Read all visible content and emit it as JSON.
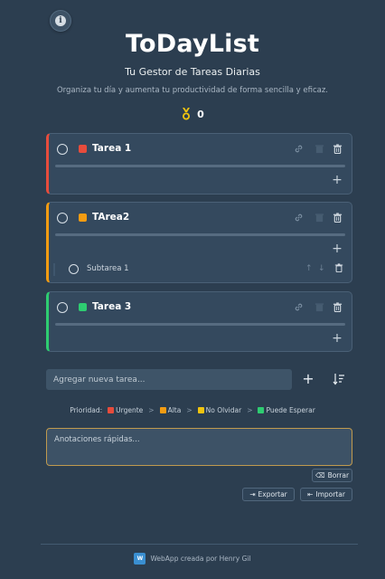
{
  "header": {
    "title": "ToDayList",
    "subtitle": "Tu Gestor de Tareas Diarias",
    "tagline": "Organiza tu día y aumenta tu productividad de forma sencilla y eficaz.",
    "medal_count": "0"
  },
  "tasks": [
    {
      "name": "Tarea 1",
      "color": "#e74c3c",
      "priority": "Urgente"
    },
    {
      "name": "TArea2",
      "color": "#f39c12",
      "priority": "Alta",
      "subtasks": [
        {
          "name": "Subtarea 1"
        }
      ]
    },
    {
      "name": "Tarea 3",
      "color": "#2ecc71",
      "priority": "Puede Esperar"
    }
  ],
  "add_task": {
    "placeholder": "Agregar nueva tarea..."
  },
  "legend": {
    "label": "Prioridad:",
    "items": [
      {
        "label": "Urgente",
        "color": "#e74c3c"
      },
      {
        "label": "Alta",
        "color": "#f39c12"
      },
      {
        "label": "No Olvidar",
        "color": "#f1c40f"
      },
      {
        "label": "Puede Esperar",
        "color": "#2ecc71"
      }
    ]
  },
  "notes": {
    "placeholder": "Anotaciones rápidas..."
  },
  "buttons": {
    "clear": "Borrar",
    "export": "Exportar",
    "import": "Importar"
  },
  "footer": {
    "credit": "WebApp creada por Henry Gil"
  }
}
